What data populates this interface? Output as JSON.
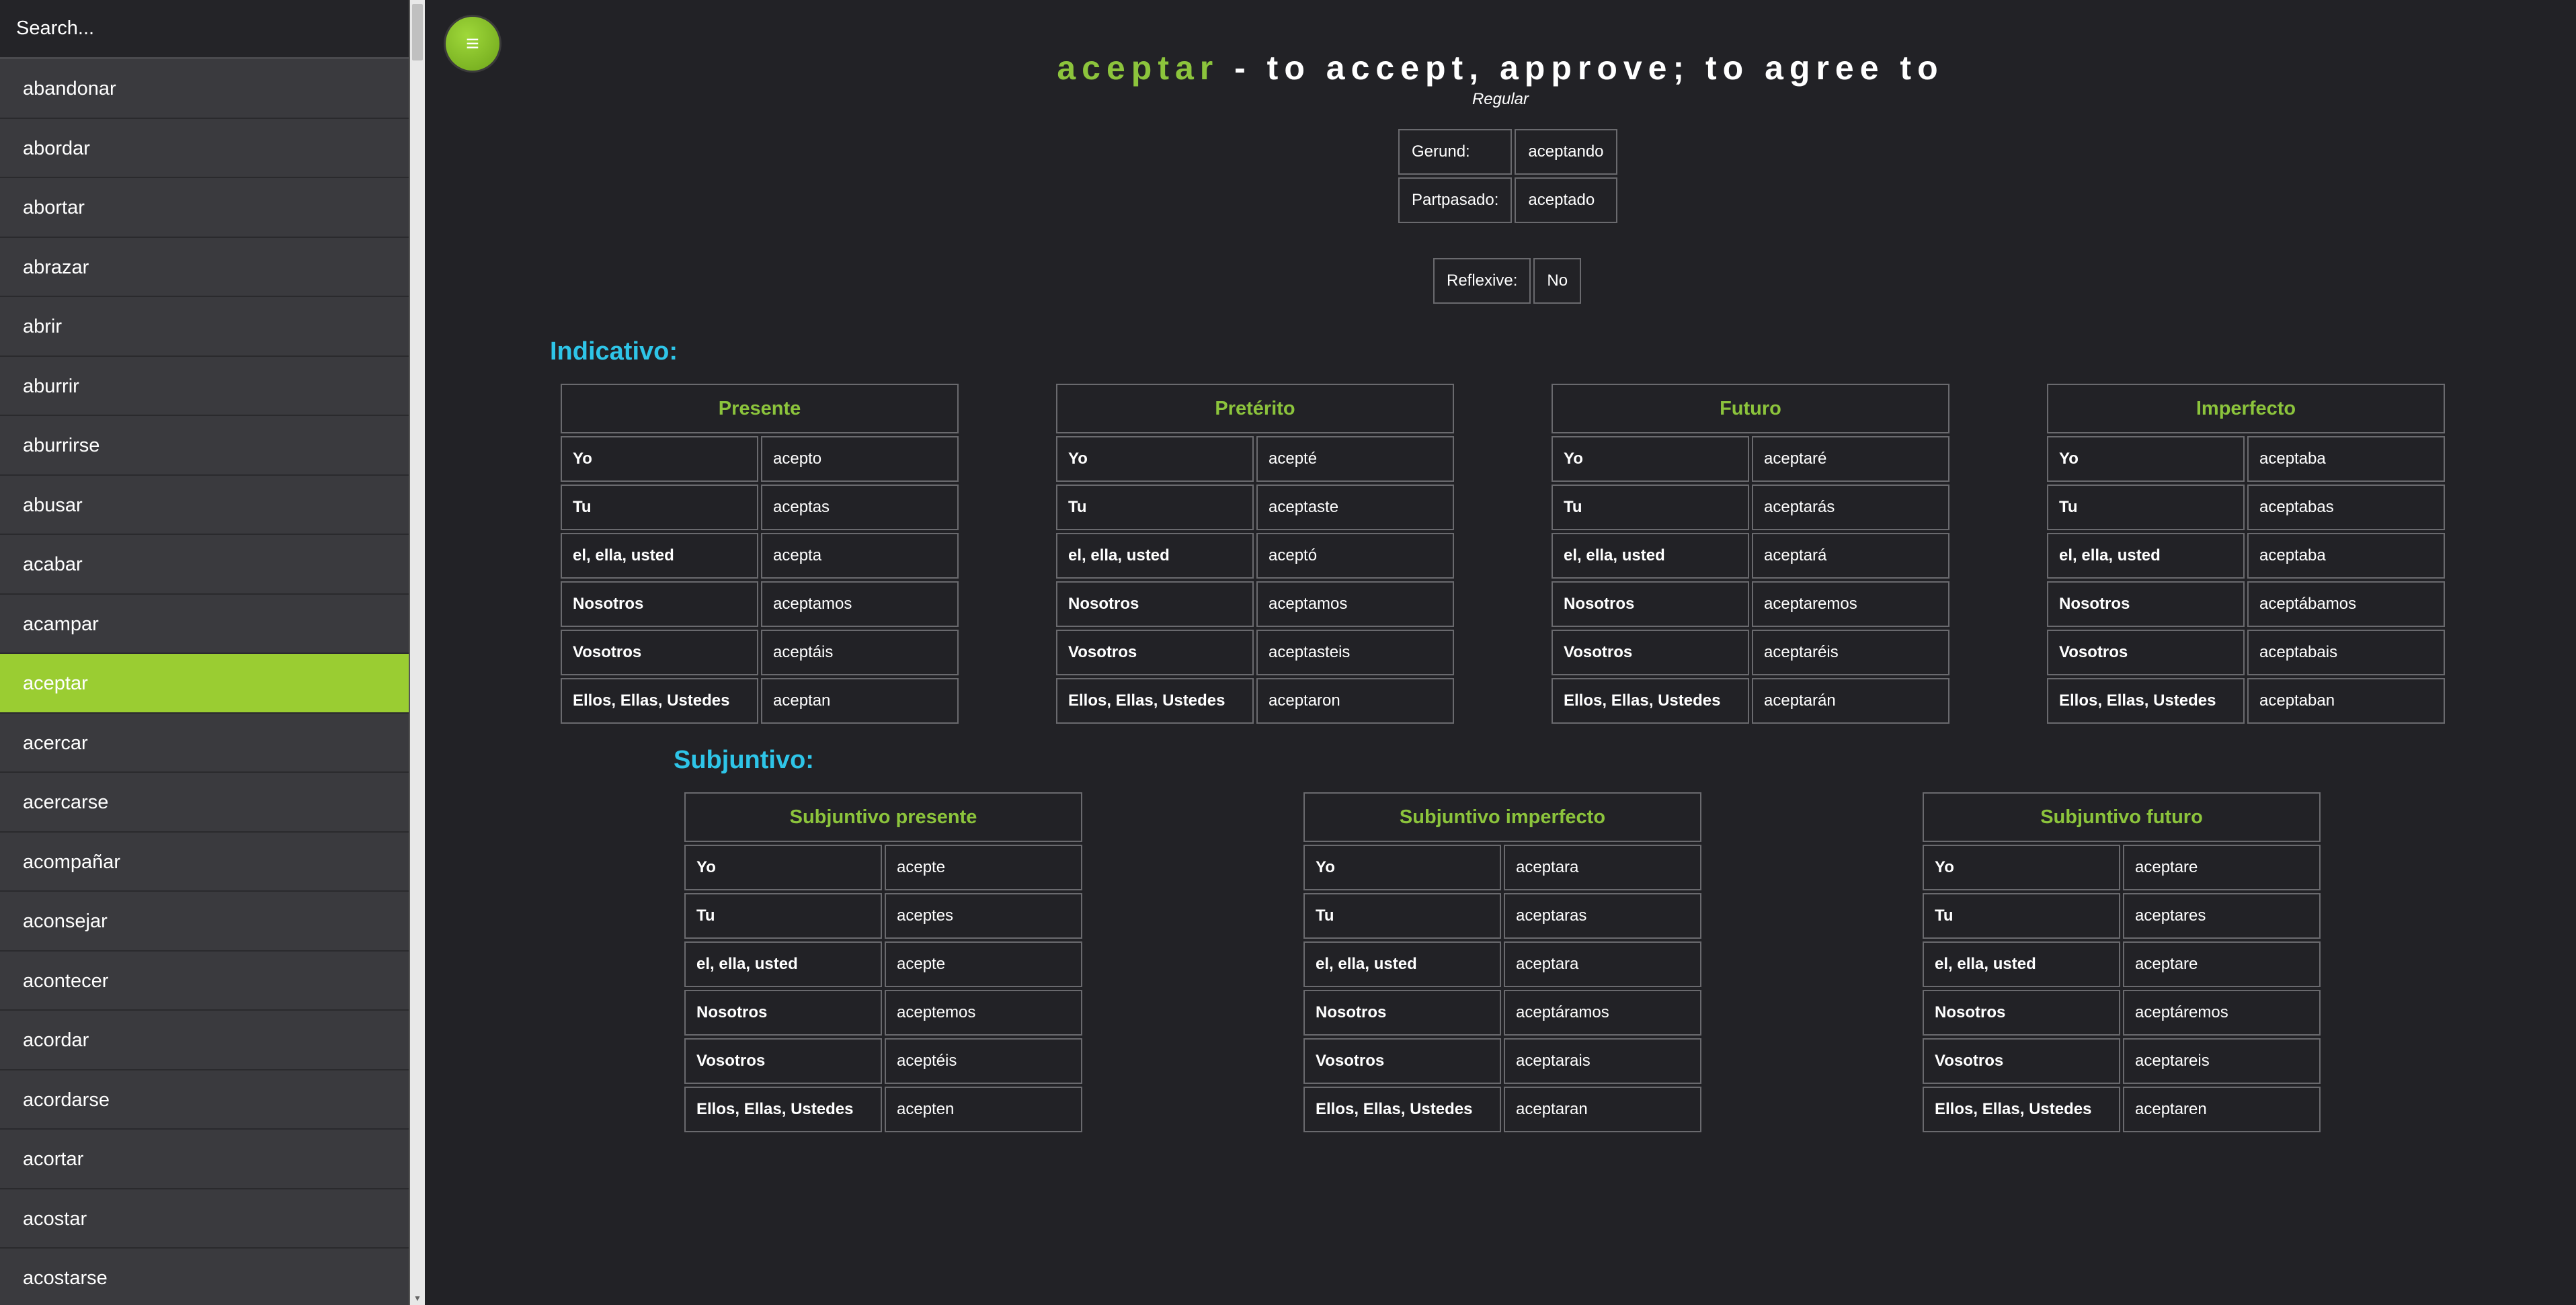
{
  "sidebar": {
    "search_placeholder": "Search...",
    "active_index": 10,
    "verbs": [
      "abandonar",
      "abordar",
      "abortar",
      "abrazar",
      "abrir",
      "aburrir",
      "aburrirse",
      "abusar",
      "acabar",
      "acampar",
      "aceptar",
      "acercar",
      "acercarse",
      "acompañar",
      "aconsejar",
      "acontecer",
      "acordar",
      "acordarse",
      "acortar",
      "acostar",
      "acostarse"
    ]
  },
  "header": {
    "menu_icon": "≡",
    "verb": "aceptar",
    "translation": " - to accept, approve; to agree to",
    "type": "Regular"
  },
  "forms": {
    "gerund_label": "Gerund:",
    "gerund_value": "aceptando",
    "partpasado_label": "Partpasado:",
    "partpasado_value": "aceptado",
    "reflexive_label": "Reflexive:",
    "reflexive_value": "No"
  },
  "pronouns": [
    "Yo",
    "Tu",
    "el, ella, usted",
    "Nosotros",
    "Vosotros",
    "Ellos, Ellas, Ustedes"
  ],
  "indicativo": {
    "title": "Indicativo:",
    "tenses": [
      {
        "name": "Presente",
        "forms": [
          "acepto",
          "aceptas",
          "acepta",
          "aceptamos",
          "aceptáis",
          "aceptan"
        ]
      },
      {
        "name": "Pretérito",
        "forms": [
          "acepté",
          "aceptaste",
          "aceptó",
          "aceptamos",
          "aceptasteis",
          "aceptaron"
        ]
      },
      {
        "name": "Futuro",
        "forms": [
          "aceptaré",
          "aceptarás",
          "aceptará",
          "aceptaremos",
          "aceptaréis",
          "aceptarán"
        ]
      },
      {
        "name": "Imperfecto",
        "forms": [
          "aceptaba",
          "aceptabas",
          "aceptaba",
          "aceptábamos",
          "aceptabais",
          "aceptaban"
        ]
      }
    ]
  },
  "subjuntivo": {
    "title": "Subjuntivo:",
    "tenses": [
      {
        "name": "Subjuntivo presente",
        "forms": [
          "acepte",
          "aceptes",
          "acepte",
          "aceptemos",
          "aceptéis",
          "acepten"
        ]
      },
      {
        "name": "Subjuntivo imperfecto",
        "forms": [
          "aceptara",
          "aceptaras",
          "aceptara",
          "aceptáramos",
          "aceptarais",
          "aceptaran"
        ]
      },
      {
        "name": "Subjuntivo futuro",
        "forms": [
          "aceptare",
          "aceptares",
          "aceptare",
          "aceptáremos",
          "aceptareis",
          "aceptaren"
        ]
      }
    ]
  }
}
